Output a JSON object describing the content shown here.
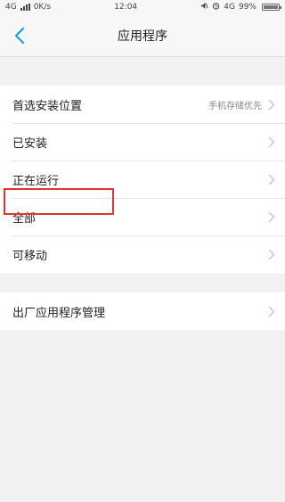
{
  "status_bar": {
    "network_left": "4G",
    "speed": "0K/s",
    "time": "12:04",
    "network_right": "4G",
    "battery": "99%"
  },
  "header": {
    "title": "应用程序",
    "back_icon": "chevron-left-icon"
  },
  "group1": {
    "items": [
      {
        "label": "首选安装位置",
        "value": "手机存储优先"
      },
      {
        "label": "已安装"
      },
      {
        "label": "正在运行"
      },
      {
        "label": "全部"
      },
      {
        "label": "可移动"
      }
    ]
  },
  "group2": {
    "items": [
      {
        "label": "出厂应用程序管理"
      }
    ]
  },
  "colors": {
    "accent": "#1a9bf0",
    "highlight": "#e33434",
    "chevron": "#c8c8c8"
  }
}
